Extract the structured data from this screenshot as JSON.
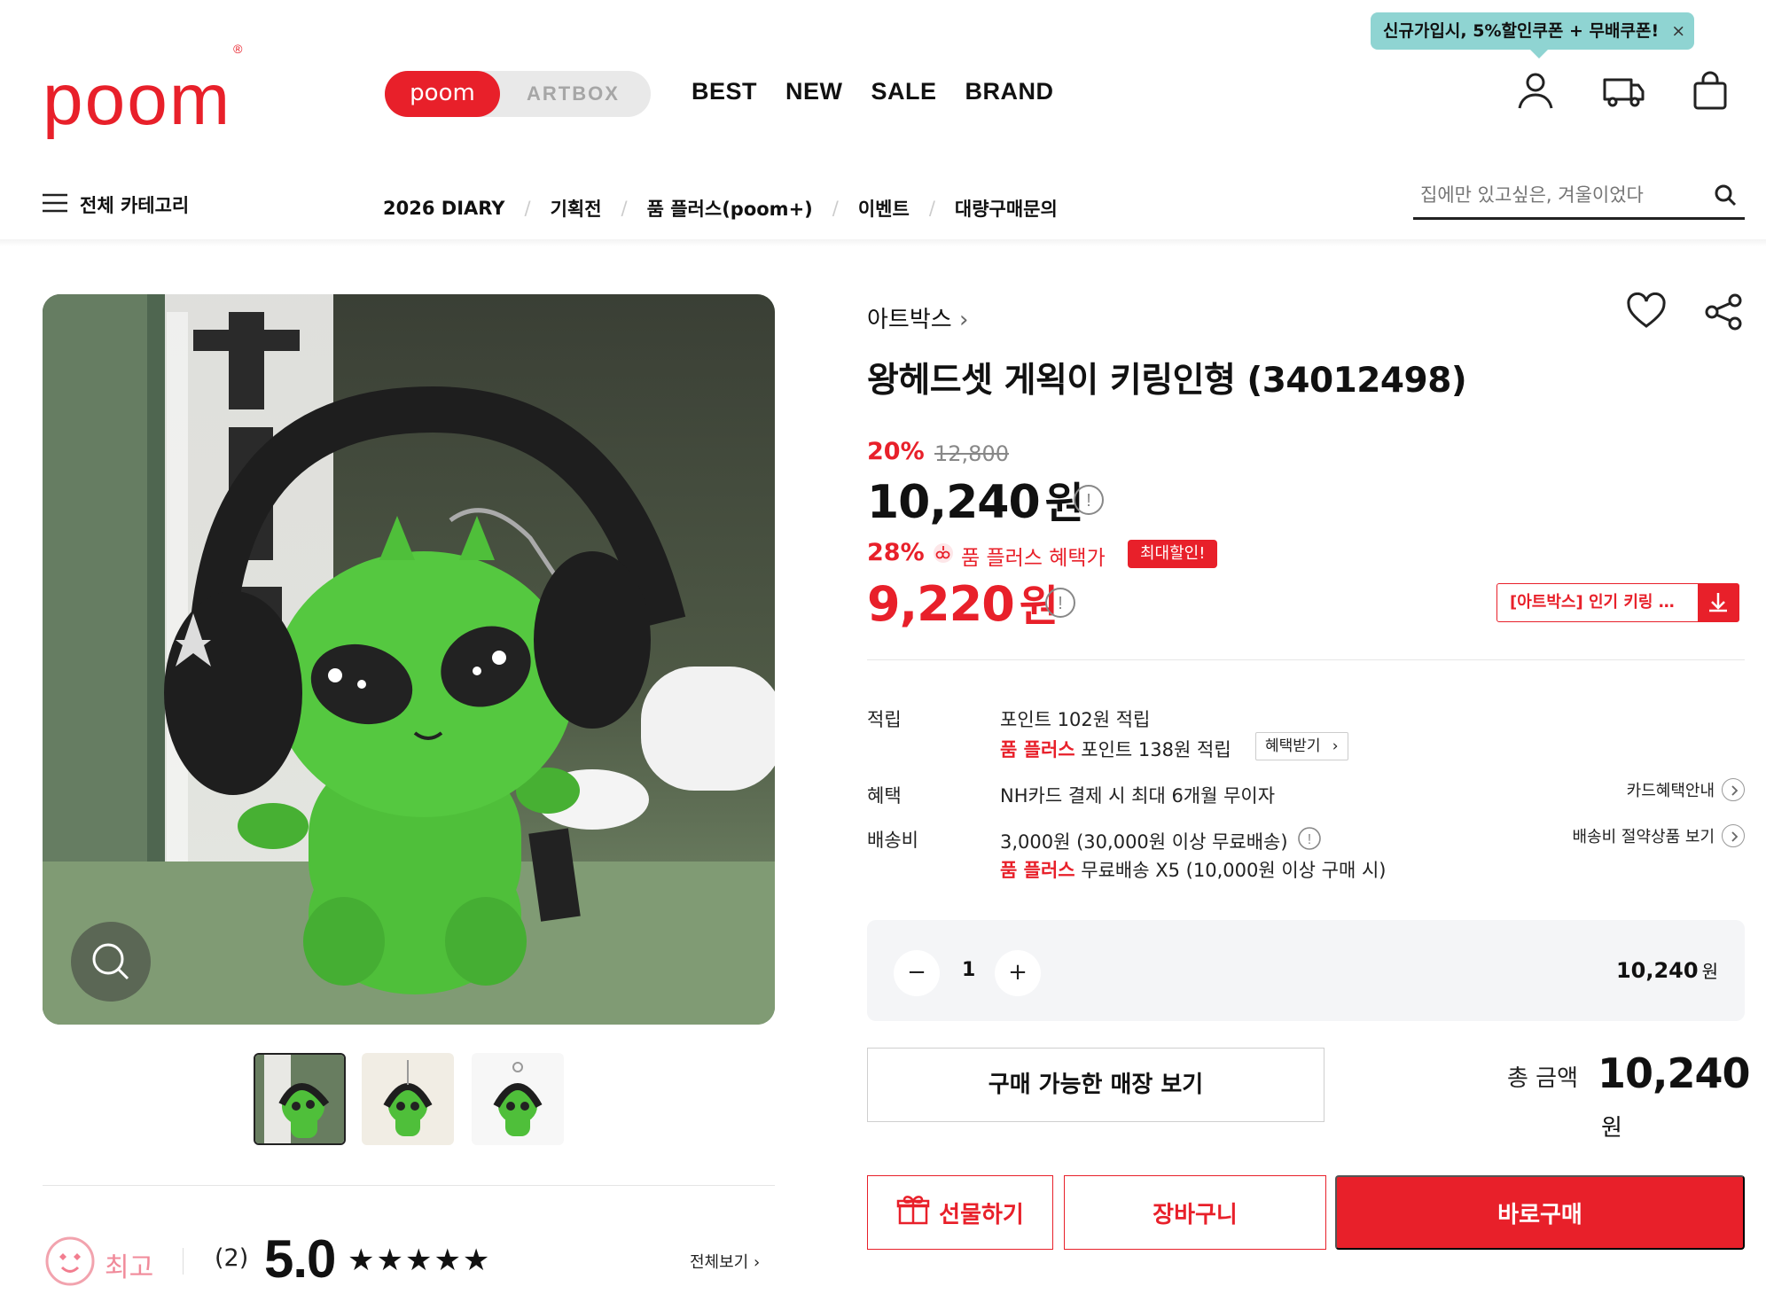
{
  "header": {
    "logo": "poom",
    "logo_mark": "®",
    "brand_toggle": {
      "poom": "poom",
      "artbox": "ARTBOX"
    },
    "main_nav": [
      "BEST",
      "NEW",
      "SALE",
      "BRAND"
    ],
    "promo": {
      "text": "신규가입시, 5%할인쿠폰 + 무배쿠폰!",
      "close": "×"
    },
    "icons": [
      "user-icon",
      "delivery-truck-icon",
      "shopping-bag-icon"
    ]
  },
  "subheader": {
    "category_label": "전체 카테고리",
    "links": [
      "2026 DIARY",
      "기획전",
      "품 플러스(poom+)",
      "이벤트",
      "대량구매문의"
    ],
    "separator": "/",
    "search_placeholder": "집에만 있고싶은, 겨울이었다"
  },
  "product": {
    "brand": "아트박스",
    "title": "왕헤드셋 게왹이 키링인형 (34012498)",
    "discount_rate": "20%",
    "original_price": "12,800",
    "price": "10,240",
    "price_unit": "원",
    "plus_discount_rate": "28%",
    "plus_label": "품 플러스 혜택가",
    "max_discount_badge": "최대할인!",
    "plus_price": "9,220",
    "coupon_text": "[아트박스] 인기 키링 …"
  },
  "details": {
    "points_label": "적립",
    "points_line1": "포인트 102원 적립",
    "points_line2_highlight": "품 플러스",
    "points_line2": "포인트 138원 적립",
    "benefit_button": "혜택받기",
    "benefit_label": "혜택",
    "benefit_value": "NH카드 결제 시 최대 6개월 무이자",
    "card_info_link": "카드혜택안내",
    "shipping_label": "배송비",
    "shipping_value": "3,000원 (30,000원 이상 무료배송)",
    "shipping_plus_highlight": "품 플러스",
    "shipping_plus_value": "무료배송 X5 (10,000원 이상 구매 시)",
    "shipping_saver_link": "배송비 절약상품 보기"
  },
  "quantity": {
    "minus": "−",
    "value": "1",
    "plus": "+",
    "line_price": "10,240",
    "unit": "원"
  },
  "store_button": "구매 가능한 매장 보기",
  "total": {
    "label": "총 금액",
    "value": "10,240",
    "unit": "원"
  },
  "actions": {
    "gift": "선물하기",
    "cart": "장바구니",
    "buy": "바로구매"
  },
  "review": {
    "badge": "최고",
    "count": "(2)",
    "score": "5.0",
    "stars": "★★★★★",
    "view_all": "전체보기"
  },
  "colors": {
    "brand_red": "#e8202a",
    "promo_teal": "#8fd4d2",
    "alien_green": "#4fbf3a"
  }
}
